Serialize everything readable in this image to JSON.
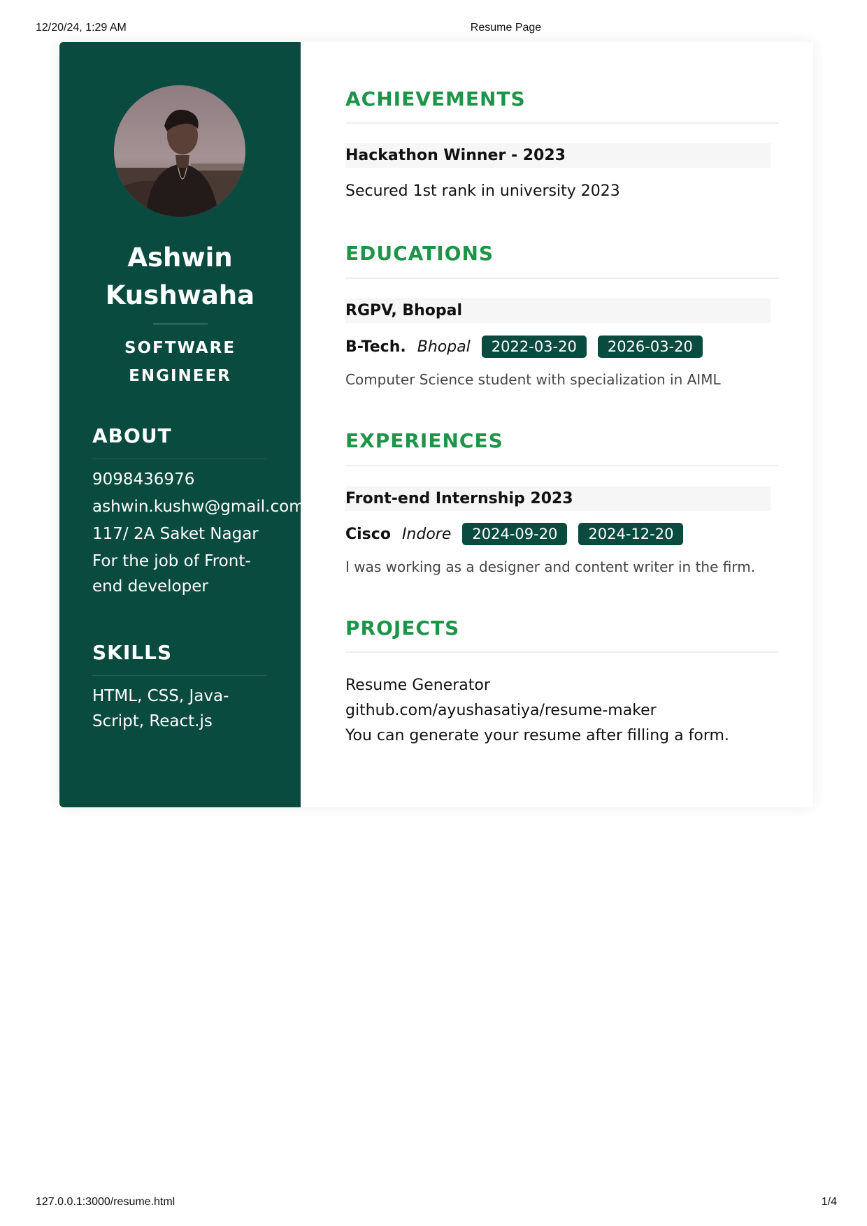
{
  "print_header": {
    "datetime": "12/20/24, 1:29 AM",
    "title": "Resume Page"
  },
  "print_footer": {
    "url": "127.0.0.1:3000/resume.html",
    "page": "1/4"
  },
  "colors": {
    "sidebar": "#0a4b40",
    "accent_heading": "#1e9448",
    "date_pill": "#0a4b40"
  },
  "profile": {
    "name_line1": "Ashwin",
    "name_line2": "Kushwaha",
    "role_line1": "SOFTWARE",
    "role_line2": "ENGINEER"
  },
  "about": {
    "heading": "ABOUT",
    "phone": "9098436976",
    "email": "ashwin.kushw@gmail.com",
    "address": "117/ 2A Saket Nagar",
    "objective": "For the job of Front-end developer"
  },
  "skills": {
    "heading": "SKILLS",
    "text": "HTML, CSS, Java-Script, React.js"
  },
  "achievements": {
    "heading": "ACHIEVEMENTS",
    "items": [
      {
        "title": "Hackathon Winner - 2023",
        "description": "Secured 1st rank in university 2023"
      }
    ]
  },
  "educations": {
    "heading": "EDUCATIONS",
    "items": [
      {
        "institution": "RGPV, Bhopal",
        "degree": "B-Tech.",
        "location": "Bhopal",
        "start": "2022-03-20",
        "end": "2026-03-20",
        "description": "Computer Science student with specialization in AIML"
      }
    ]
  },
  "experiences": {
    "heading": "EXPERIENCES",
    "items": [
      {
        "title": "Front-end Internship 2023",
        "company": "Cisco",
        "location": "Indore",
        "start": "2024-09-20",
        "end": "2024-12-20",
        "description": "I was working as a designer and content writer in the firm."
      }
    ]
  },
  "projects": {
    "heading": "PROJECTS",
    "items": [
      {
        "name": "Resume Generator",
        "link": "github.com/ayushasatiya/resume-maker",
        "description": "You can generate your resume after filling a form."
      }
    ]
  }
}
